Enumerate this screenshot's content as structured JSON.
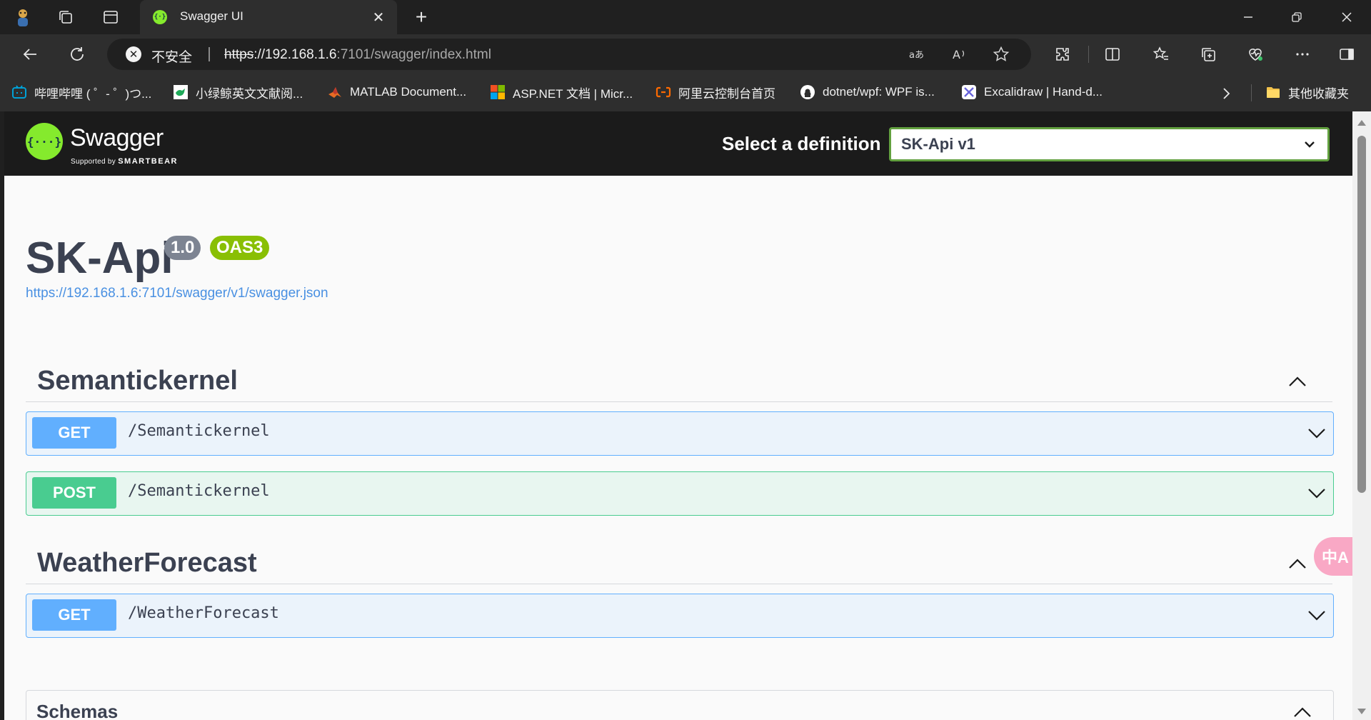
{
  "browser": {
    "tab": {
      "title": "Swagger UI",
      "close": "✕"
    },
    "new_tab": "+",
    "address": {
      "security_text": "不安全",
      "url_scheme": "https",
      "url_sep": "://",
      "url_host": "192.168.1.6",
      "url_rest": ":7101/swagger/index.html"
    },
    "bookmarks": [
      {
        "label": "哔哩哔哩 ( ゜- ゜)つ...",
        "icon": "bilibili-icon",
        "color": "#00a1d6"
      },
      {
        "label": "小绿鲸英文文献阅...",
        "icon": "green-whale-icon",
        "color": "#ffffff"
      },
      {
        "label": "MATLAB Document...",
        "icon": "matlab-icon",
        "color": "#e76b23"
      },
      {
        "label": "ASP.NET 文档 | Micr...",
        "icon": "microsoft-icon",
        "color": "#f25022"
      },
      {
        "label": "阿里云控制台首页",
        "icon": "aliyun-icon",
        "color": "#ff6a00"
      },
      {
        "label": "dotnet/wpf: WPF is...",
        "icon": "github-icon",
        "color": "#ffffff"
      },
      {
        "label": "Excalidraw | Hand-d...",
        "icon": "excalidraw-icon",
        "color": "#6965db"
      }
    ],
    "other_bookmarks": "其他收藏夹"
  },
  "swagger": {
    "brand": "Swagger",
    "supported_by": "Supported by",
    "smartbear": "SMARTBEAR",
    "select_label": "Select a definition",
    "selected_definition": "SK-Api v1",
    "api_title": "SK-Api",
    "version": "1.0",
    "oas": "OAS3",
    "spec_url": "https://192.168.1.6:7101/swagger/v1/swagger.json",
    "sections": [
      {
        "name": "Semantickernel",
        "operations": [
          {
            "method": "GET",
            "path": "/Semantickernel"
          },
          {
            "method": "POST",
            "path": "/Semantickernel"
          }
        ]
      },
      {
        "name": "WeatherForecast",
        "operations": [
          {
            "method": "GET",
            "path": "/WeatherForecast"
          }
        ]
      }
    ],
    "schemas_label": "Schemas"
  },
  "colors": {
    "get": "#61affe",
    "post": "#49cc90",
    "swagger_green": "#85ea2d",
    "select_border": "#62a03f"
  },
  "translate_fab": "中A"
}
